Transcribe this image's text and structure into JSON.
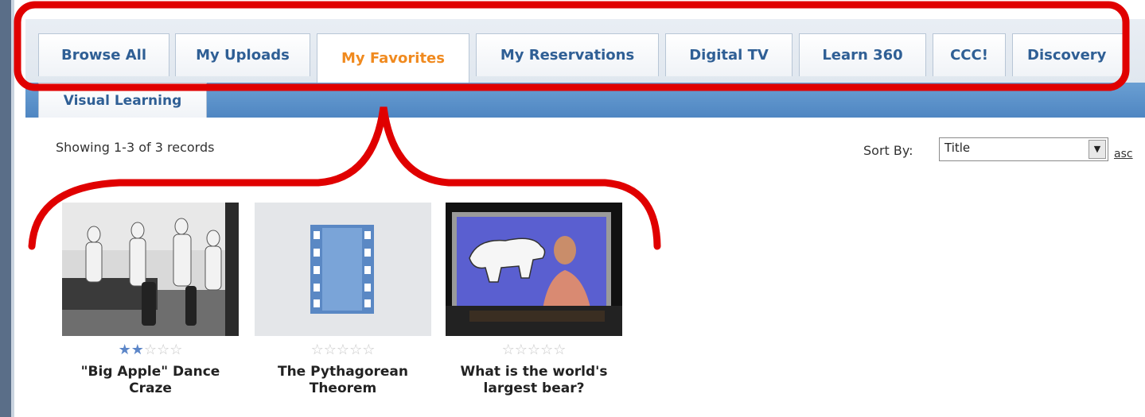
{
  "tabs": [
    {
      "label": "Browse All",
      "active": false
    },
    {
      "label": "My Uploads",
      "active": false
    },
    {
      "label": "My Favorites",
      "active": true
    },
    {
      "label": "My Reservations",
      "active": false
    },
    {
      "label": "Digital TV",
      "active": false
    },
    {
      "label": "Learn 360",
      "active": false
    },
    {
      "label": "CCC!",
      "active": false
    },
    {
      "label": "Discovery",
      "active": false
    }
  ],
  "second_row_tab": {
    "label": "Visual Learning"
  },
  "results": {
    "summary": "Showing 1-3 of 3 records"
  },
  "sort": {
    "label": "Sort By:",
    "selected": "Title",
    "order_link": "asc"
  },
  "items": [
    {
      "title": "\"Big Apple\" Dance Craze",
      "rating": 2,
      "max_rating": 5
    },
    {
      "title": "The Pythagorean Theorem",
      "rating": 0,
      "max_rating": 5
    },
    {
      "title": "What is the world's largest bear?",
      "rating": 0,
      "max_rating": 5
    }
  ],
  "colors": {
    "active_tab": "#f08a1f",
    "tab_text": "#2f5f95",
    "highlight": "#e00000",
    "tab_strip": "#4f86c2"
  }
}
